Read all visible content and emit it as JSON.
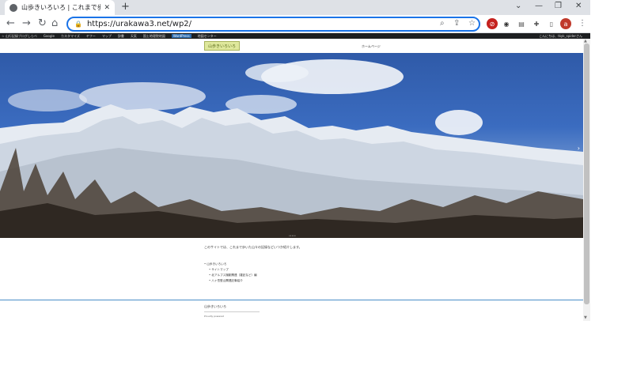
{
  "browser": {
    "tab_title": "山歩きいろいろ | これまで歩いた山々",
    "url": "https://urakawa3.net/wp2/",
    "profile_initial": "a"
  },
  "bookmarks": {
    "items": [
      "☆ 山行記録ブログしらべ",
      "Google",
      "カスタマイズ",
      "ヤフー",
      "マップ",
      "辞書",
      "天気",
      "国土地理院地図",
      "WordPress",
      "地図センター"
    ],
    "right_text": "こんにちは、tkyk_spiderさん"
  },
  "site": {
    "logo": "山歩きいろいろ",
    "nav": "ホームページ",
    "intro": "このサイトでは、これまで歩いた山々の記録などいつか紹介します。",
    "list": [
      "山歩きいろいろ",
      "サイトマップ",
      "北アルプス撮影関連（雑記など）編",
      "八ヶ岳登山関連記事紹介"
    ],
    "footer_title": "山歩きいろいろ",
    "footer_link": "Proudly powered"
  },
  "colors": {
    "accent": "#1a73e8",
    "footer_line": "#4a8ec7",
    "logo_bg": "#dfe89c"
  }
}
